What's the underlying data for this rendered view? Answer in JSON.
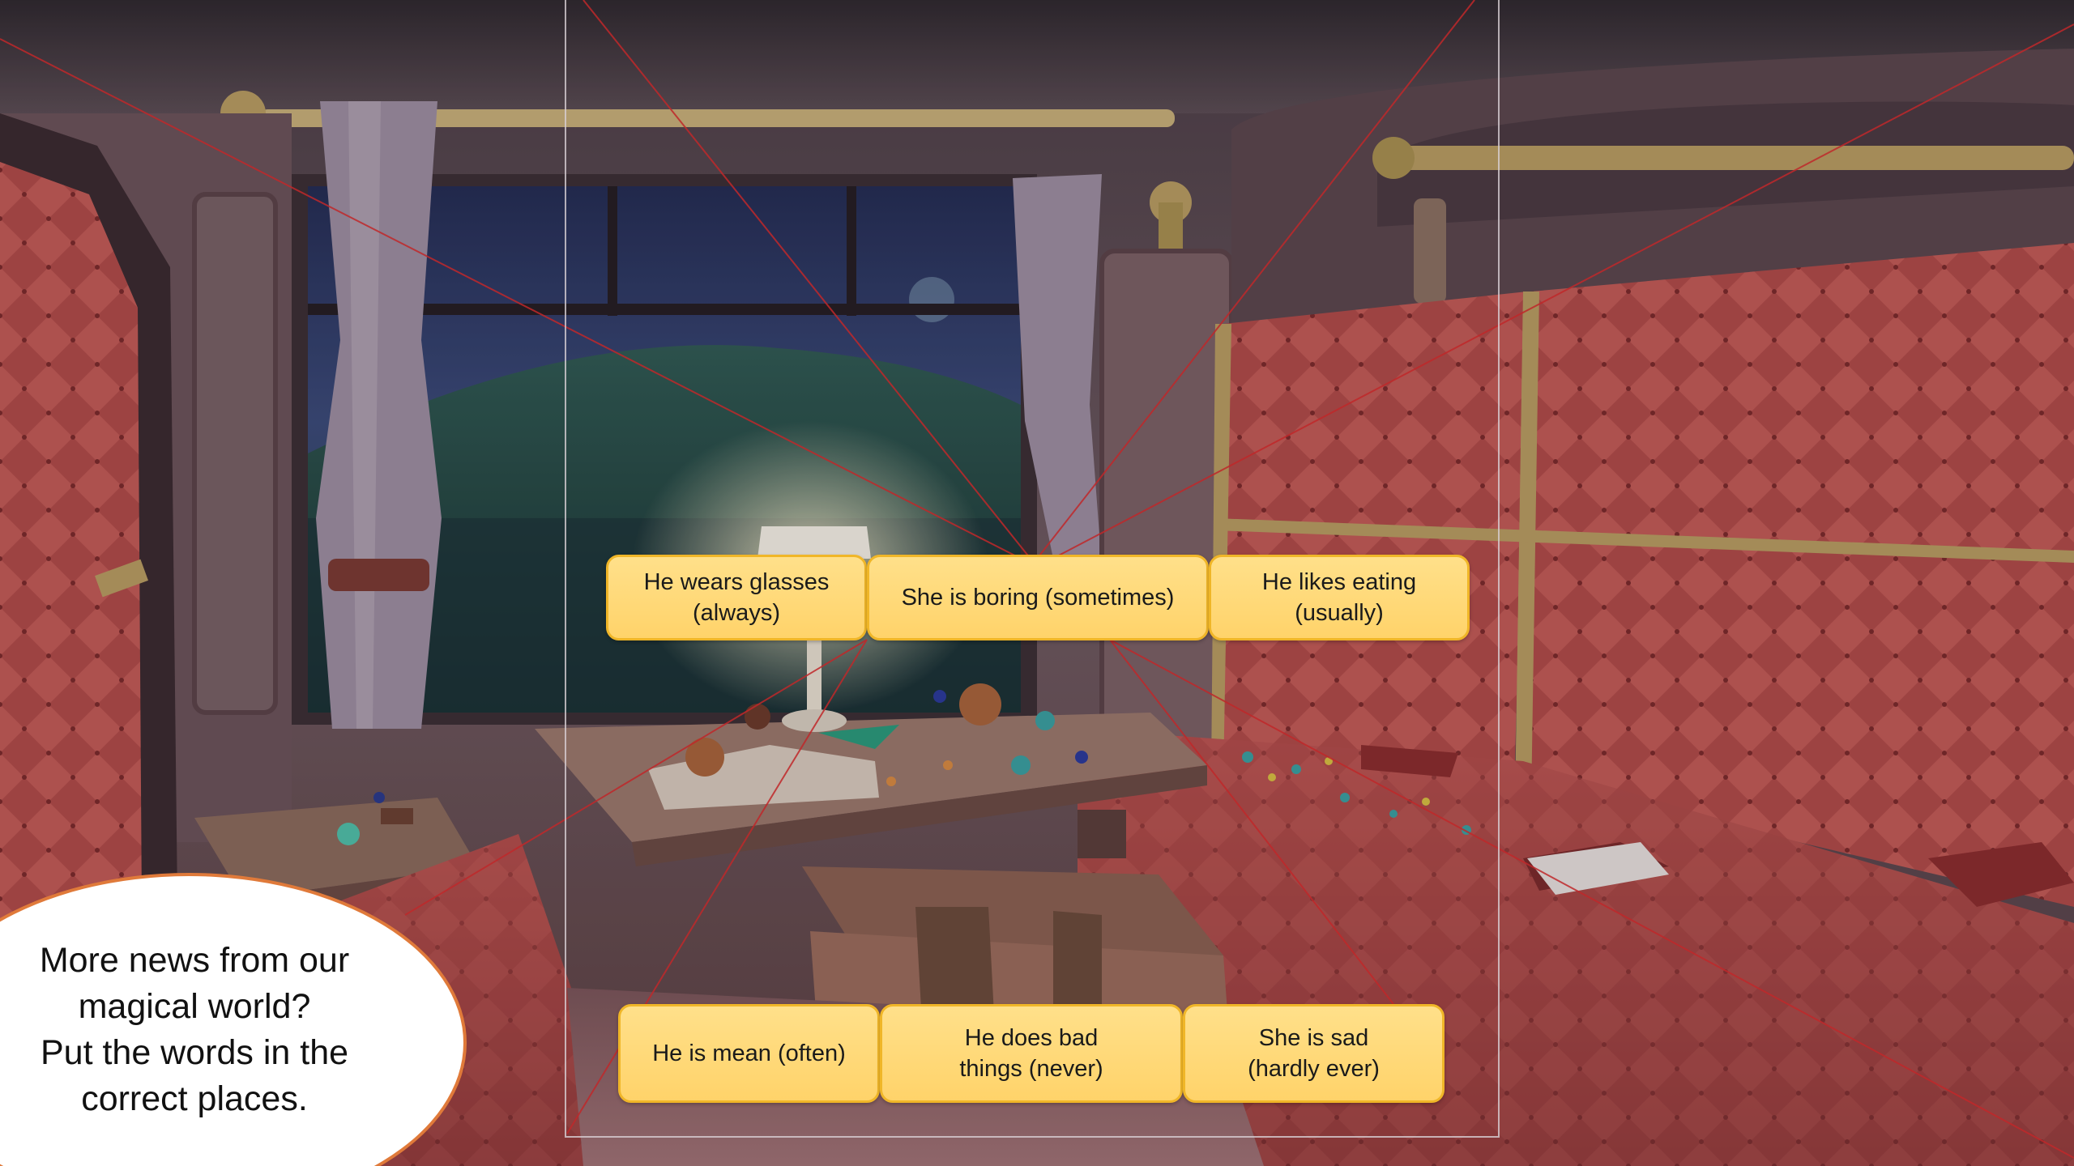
{
  "tiles_top": [
    {
      "line1": "He wears glasses",
      "line2": "(always)"
    },
    {
      "line1": "She is boring (sometimes)",
      "line2": ""
    },
    {
      "line1": "He likes eating",
      "line2": "(usually)"
    }
  ],
  "tiles_bottom": [
    {
      "line1": "He is mean (often)",
      "line2": ""
    },
    {
      "line1": "He does bad",
      "line2": "things (never)"
    },
    {
      "line1": "She is sad",
      "line2": "(hardly ever)"
    }
  ],
  "instructions": {
    "line1": "More news from our",
    "line2": "magical world?",
    "line3": "Put the words in the",
    "line4": "correct places."
  },
  "colors": {
    "tile_fill": "#ffd36a",
    "tile_border": "#f0b628",
    "bubble_border": "#e07a3a",
    "guide_line": "#c0282a"
  }
}
